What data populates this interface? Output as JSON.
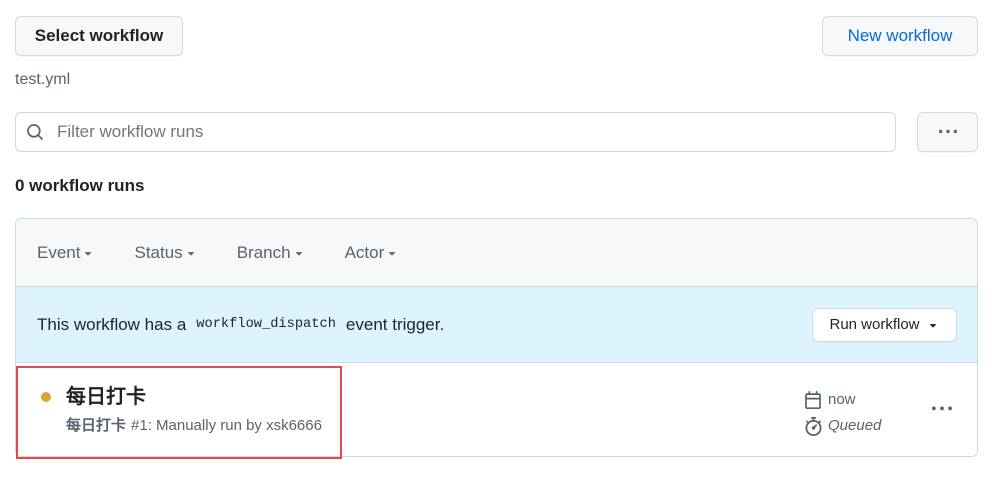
{
  "header": {
    "select_workflow_label": "Select workflow",
    "new_workflow_label": "New workflow",
    "workflow_file": "test.yml"
  },
  "search": {
    "placeholder": "Filter workflow runs",
    "value": ""
  },
  "runs_count": "0 workflow runs",
  "filters": [
    {
      "label": "Event"
    },
    {
      "label": "Status"
    },
    {
      "label": "Branch"
    },
    {
      "label": "Actor"
    }
  ],
  "banner": {
    "text_before": "This workflow has a",
    "code": "workflow_dispatch",
    "text_after": "event trigger.",
    "run_button_label": "Run workflow"
  },
  "runs": [
    {
      "title": "每日打卡",
      "workflow_name": "每日打卡",
      "detail": "#1: Manually run by xsk6666",
      "time": "now",
      "status": "Queued"
    }
  ],
  "icons": {
    "search": "search-icon",
    "more": "kebab-horizontal-icon",
    "dropdown": "triangle-down-icon",
    "time": "calendar-icon",
    "duration": "stopwatch-icon",
    "status": "status-dot-icon"
  },
  "colors": {
    "accent": "#0969da",
    "status_dot": "#d4a72c",
    "banner_bg": "#ddf4ff",
    "highlight": "#e5484d"
  }
}
